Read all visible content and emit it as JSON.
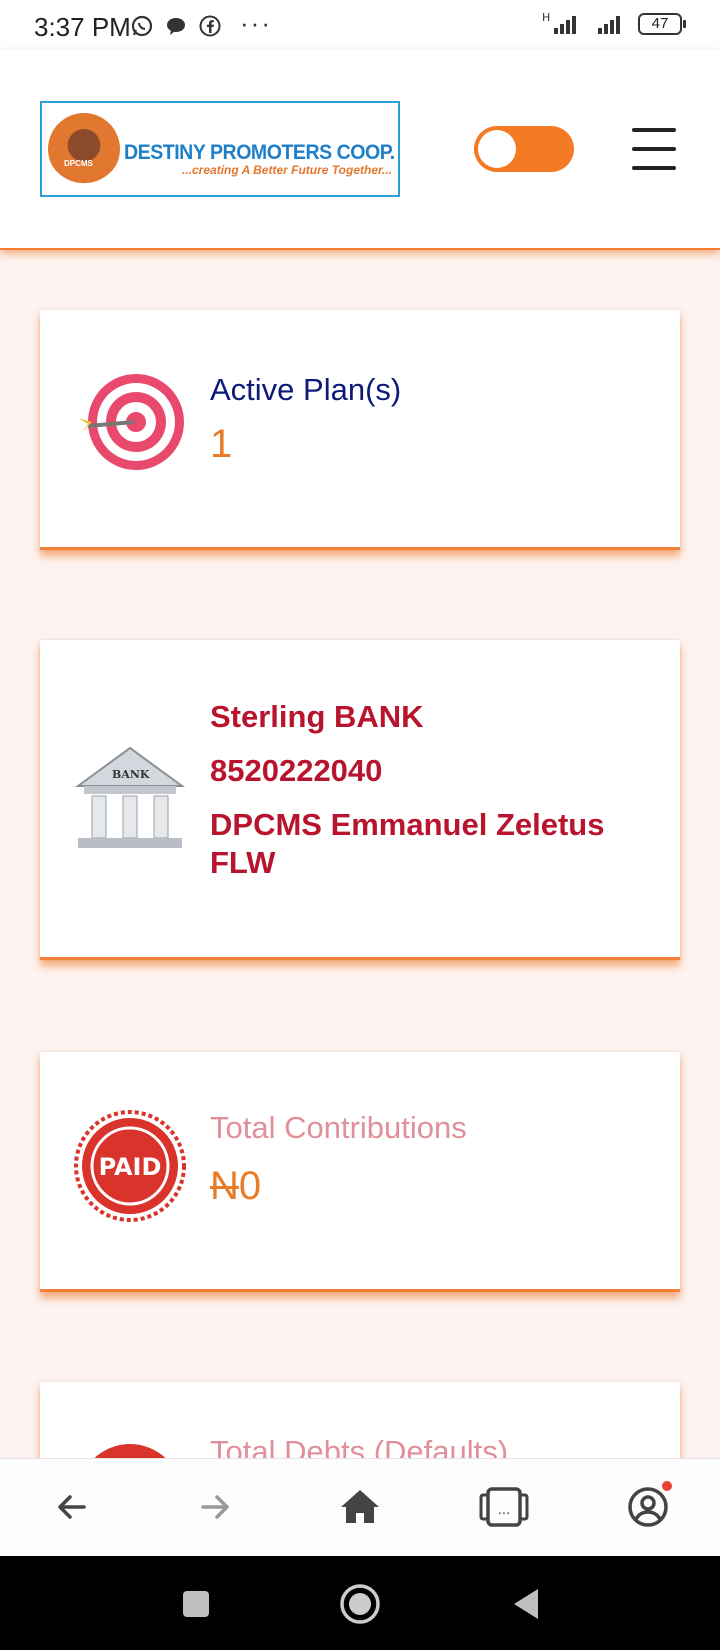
{
  "status_bar": {
    "time": "3:37 PM",
    "icons": [
      "whatsapp-icon",
      "message-icon",
      "facebook-icon"
    ],
    "more": "···",
    "network_label": "H",
    "battery": "47"
  },
  "header": {
    "logo_title": "DESTINY PROMOTERS COOP.",
    "logo_tagline": "...creating A Better Future Together...",
    "logo_seal_text": "DPCMS",
    "theme_toggle": "off",
    "menu_icon": "hamburger-icon"
  },
  "cards": {
    "active_plans": {
      "label": "Active Plan(s)",
      "value": "1",
      "icon": "target-icon"
    },
    "bank": {
      "bank_name": "Sterling BANK",
      "account_number": "8520222040",
      "account_name": "DPCMS Emmanuel Zeletus FLW",
      "icon": "bank-icon",
      "icon_text": "BANK"
    },
    "contributions": {
      "label": "Total Contributions",
      "currency": "N",
      "amount": "0",
      "icon": "paid-stamp-icon",
      "icon_text": "PAID"
    },
    "debts": {
      "label": "Total Debts (Defaults)"
    }
  },
  "browser_nav": [
    "back-icon",
    "forward-icon",
    "home-icon",
    "tabs-icon",
    "account-icon"
  ],
  "tabs_label": "...",
  "colors": {
    "accent_orange": "#f47a24",
    "navy": "#0c1a7a",
    "crimson": "#b8142e",
    "pink": "#e0909a"
  }
}
